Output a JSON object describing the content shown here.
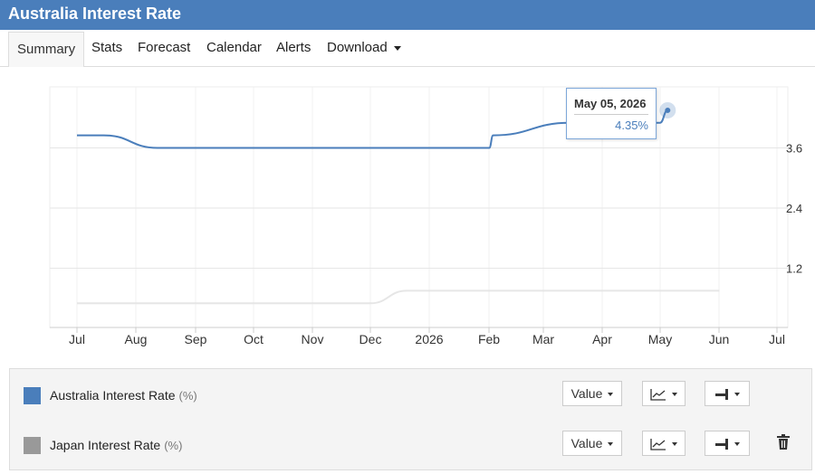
{
  "header": {
    "title": "Australia Interest Rate"
  },
  "tabs": [
    {
      "label": "Summary"
    },
    {
      "label": "Stats"
    },
    {
      "label": "Forecast"
    },
    {
      "label": "Calendar"
    },
    {
      "label": "Alerts"
    },
    {
      "label": "Download"
    }
  ],
  "tooltip": {
    "date": "May 05, 2026",
    "value": "4.35%"
  },
  "chart_data": {
    "type": "line",
    "x_ticks": [
      "Jul",
      "Aug",
      "Sep",
      "Oct",
      "Nov",
      "Dec",
      "2026",
      "Feb",
      "Mar",
      "Apr",
      "May",
      "Jun",
      "Jul"
    ],
    "y_ticks": [
      1.2,
      2.4,
      3.6
    ],
    "y_axis_position": "right",
    "series": [
      {
        "name": "Australia Interest Rate",
        "color": "#4a7ebb",
        "points": [
          [
            "2025-07-01",
            3.85
          ],
          [
            "2025-07-15",
            3.85
          ],
          [
            "2025-08-12",
            3.6
          ],
          [
            "2025-12-31",
            3.6
          ],
          [
            "2026-02-01",
            3.6
          ],
          [
            "2026-02-03",
            3.85
          ],
          [
            "2026-03-15",
            4.1
          ],
          [
            "2026-04-15",
            4.1
          ],
          [
            "2026-05-01",
            4.1
          ],
          [
            "2026-05-05",
            4.35
          ]
        ]
      },
      {
        "name": "Japan Interest Rate",
        "color": "#e6e6e6",
        "points": [
          [
            "2025-07-01",
            0.5
          ],
          [
            "2025-12-01",
            0.5
          ],
          [
            "2025-12-20",
            0.75
          ],
          [
            "2026-06-01",
            0.75
          ]
        ]
      }
    ]
  },
  "legend": [
    {
      "name": "Australia Interest Rate",
      "unit": "(%)",
      "color": "#4a7ebb",
      "value_label": "Value"
    },
    {
      "name": "Japan Interest Rate",
      "unit": "(%)",
      "color": "#999999",
      "value_label": "Value"
    }
  ]
}
